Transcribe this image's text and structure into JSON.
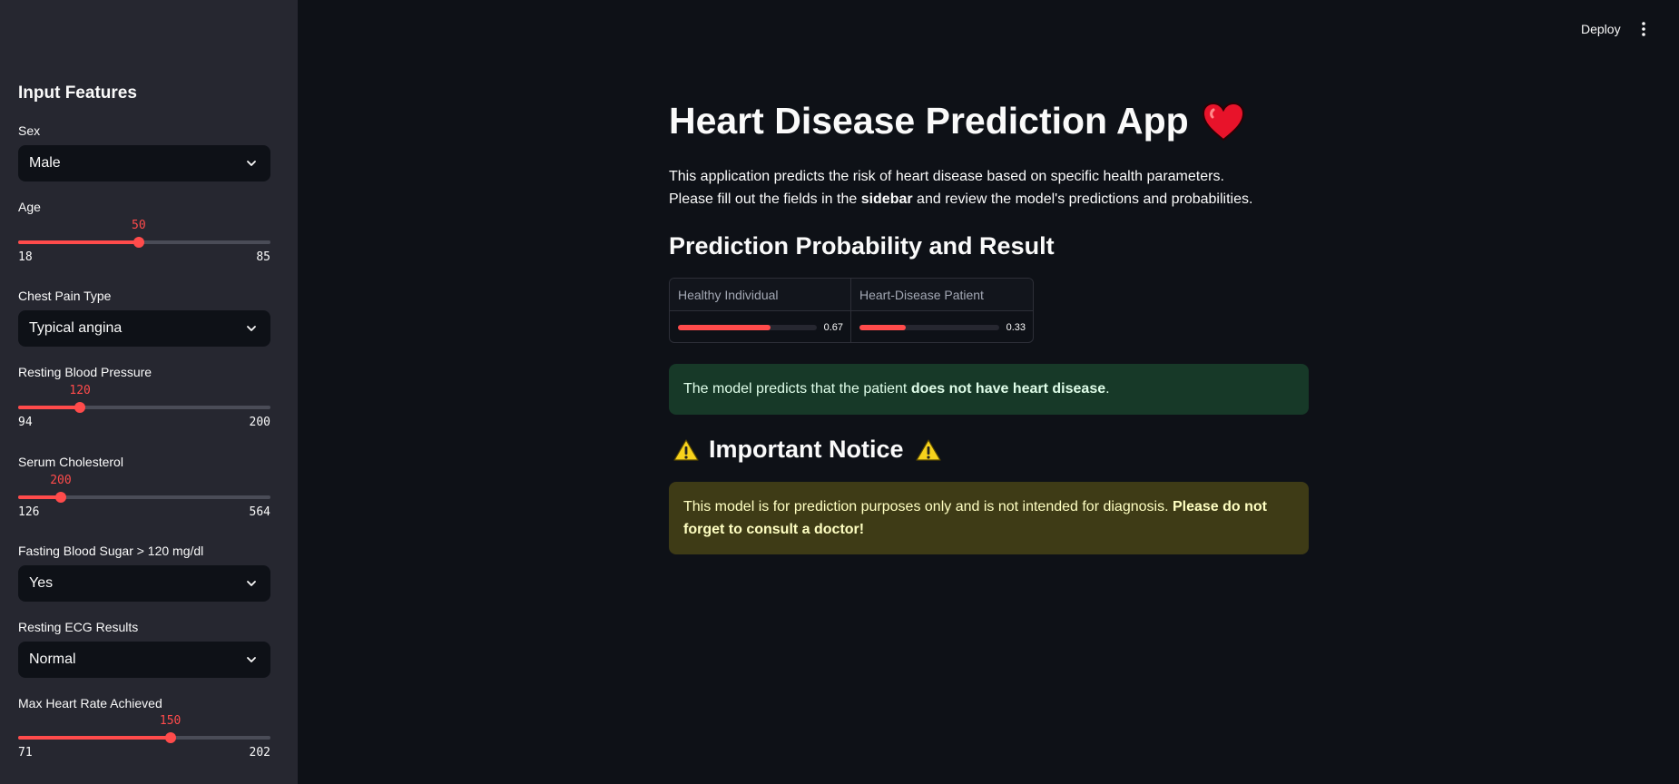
{
  "header": {
    "deploy_label": "Deploy"
  },
  "sidebar": {
    "title": "Input Features",
    "sex": {
      "label": "Sex",
      "value": "Male"
    },
    "age": {
      "label": "Age",
      "value": "50",
      "min": "18",
      "max": "85",
      "fraction": 0.478
    },
    "chest_pain": {
      "label": "Chest Pain Type",
      "value": "Typical angina"
    },
    "resting_bp": {
      "label": "Resting Blood Pressure",
      "value": "120",
      "min": "94",
      "max": "200",
      "fraction": 0.245
    },
    "cholesterol": {
      "label": "Serum Cholesterol",
      "value": "200",
      "min": "126",
      "max": "564",
      "fraction": 0.169
    },
    "fasting_bs": {
      "label": "Fasting Blood Sugar > 120 mg/dl",
      "value": "Yes"
    },
    "resting_ecg": {
      "label": "Resting ECG Results",
      "value": "Normal"
    },
    "max_hr": {
      "label": "Max Heart Rate Achieved",
      "value": "150",
      "min": "71",
      "max": "202",
      "fraction": 0.603
    }
  },
  "main": {
    "title": "Heart Disease Prediction App",
    "intro_line1": "This application predicts the risk of heart disease based on specific health parameters.",
    "intro_line2_pre": "Please fill out the fields in the ",
    "intro_line2_bold": "sidebar",
    "intro_line2_post": " and review the model's predictions and probabilities.",
    "prediction_heading": "Prediction Probability and Result",
    "probabilities": [
      {
        "label": "Healthy Individual",
        "value": "0.67",
        "fraction": 0.67
      },
      {
        "label": "Heart-Disease Patient",
        "value": "0.33",
        "fraction": 0.33
      }
    ],
    "result_pre": "The model predicts that the patient ",
    "result_bold": "does not have heart disease",
    "result_post": ".",
    "notice_heading": "Important Notice",
    "notice_text": "This model is for prediction purposes only and is not intended for diagnosis. ",
    "notice_bold": "Please do not forget to consult a doctor!"
  },
  "colors": {
    "accent": "#ff4b4b",
    "background": "#0e1117",
    "sidebar": "#262730",
    "success_bg": "#173928",
    "warning_bg": "#3e3b16"
  },
  "icons": {
    "title_icon": "heart-icon",
    "notice_icon": "warning-icon"
  }
}
